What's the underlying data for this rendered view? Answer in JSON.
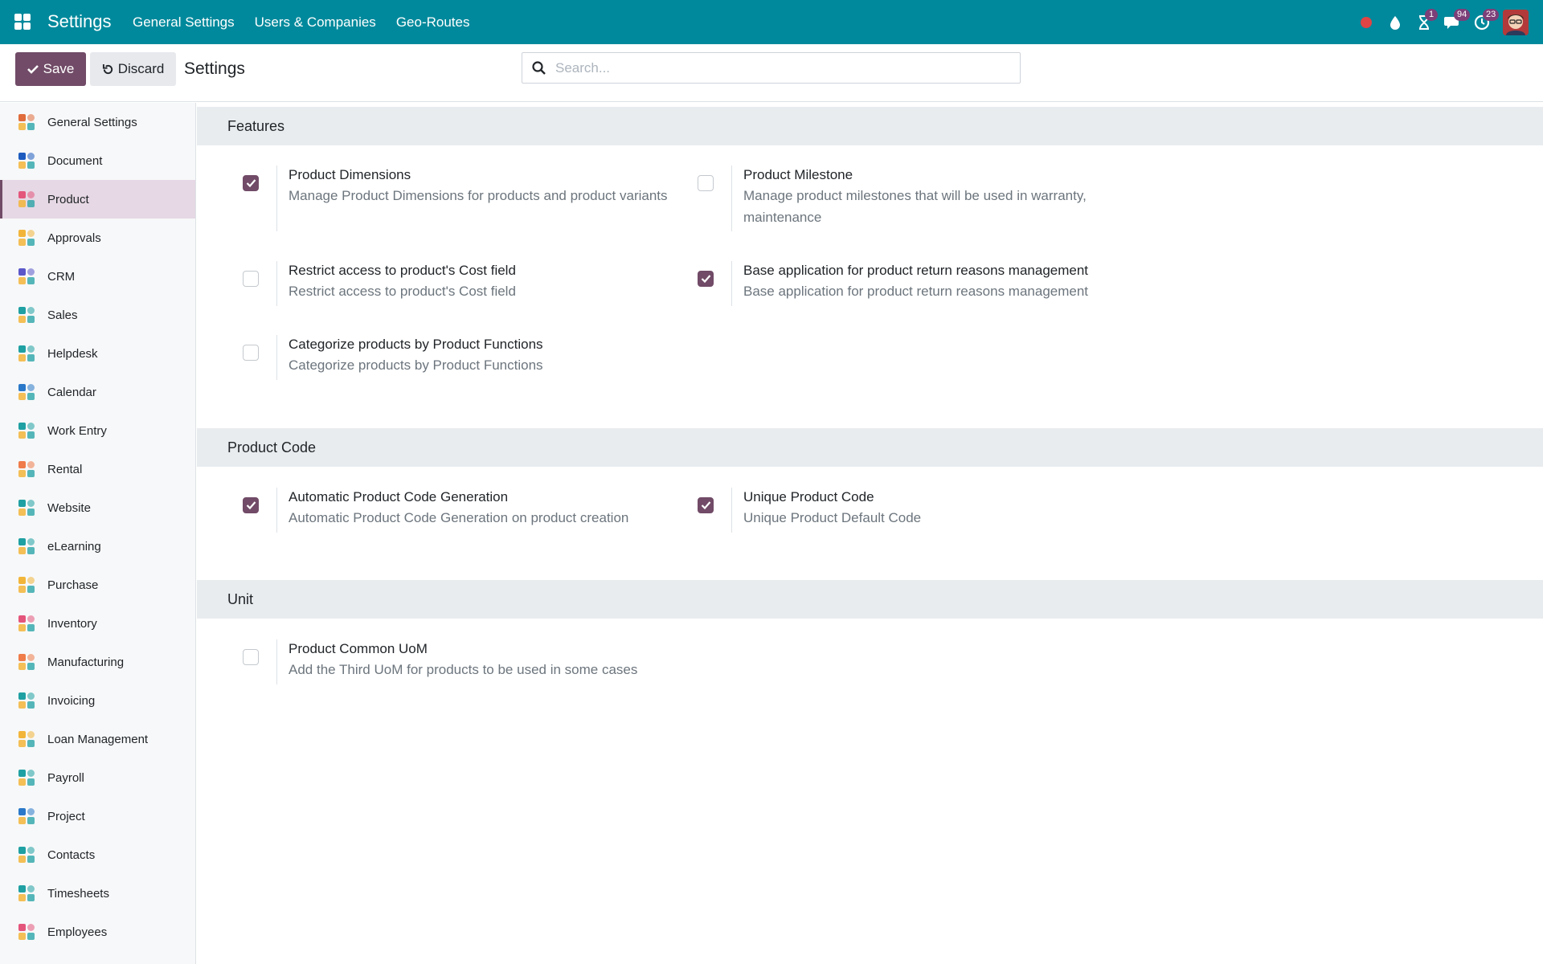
{
  "navbar": {
    "brand": "Settings",
    "menu": [
      "General Settings",
      "Users & Companies",
      "Geo-Routes"
    ],
    "tray": [
      {
        "icon": "record-dot-icon",
        "badge": null
      },
      {
        "icon": "drop-icon",
        "badge": null
      },
      {
        "icon": "hourglass-icon",
        "badge": "1"
      },
      {
        "icon": "chat-icon",
        "badge": "94"
      },
      {
        "icon": "clock-icon",
        "badge": "23"
      }
    ],
    "badge_color": "#7c3f78",
    "bar_color": "#00899c"
  },
  "control": {
    "save_label": "Save",
    "discard_label": "Discard",
    "title": "Settings",
    "search_placeholder": "Search..."
  },
  "sidebar": {
    "active": "Product",
    "items": [
      {
        "label": "General Settings",
        "icon": "settings-hexagon-icon",
        "color": "#e06b3c"
      },
      {
        "label": "Document",
        "icon": "folder-icon",
        "color": "#1d5bbf"
      },
      {
        "label": "Product",
        "icon": "product-blocks-icon",
        "color": "#e4557c"
      },
      {
        "label": "Approvals",
        "icon": "approvals-person-icon",
        "color": "#f2b53a"
      },
      {
        "label": "CRM",
        "icon": "crm-handshake-icon",
        "color": "#5b57c9"
      },
      {
        "label": "Sales",
        "icon": "sales-chart-icon",
        "color": "#1fa0a3"
      },
      {
        "label": "Helpdesk",
        "icon": "helpdesk-headset-icon",
        "color": "#1fa0a3"
      },
      {
        "label": "Calendar",
        "icon": "calendar-icon",
        "color": "#2a78c9"
      },
      {
        "label": "Work Entry",
        "icon": "work-entry-person-icon",
        "color": "#1fa0a3"
      },
      {
        "label": "Rental",
        "icon": "rental-hand-icon",
        "color": "#ef7c4a"
      },
      {
        "label": "Website",
        "icon": "website-globe-icon",
        "color": "#1fa0a3"
      },
      {
        "label": "eLearning",
        "icon": "elearning-board-icon",
        "color": "#1fa0a3"
      },
      {
        "label": "Purchase",
        "icon": "purchase-card-icon",
        "color": "#f2b53a"
      },
      {
        "label": "Inventory",
        "icon": "inventory-box-icon",
        "color": "#e4557c"
      },
      {
        "label": "Manufacturing",
        "icon": "manufacturing-factory-icon",
        "color": "#ef7c4a"
      },
      {
        "label": "Invoicing",
        "icon": "invoicing-dollar-icon",
        "color": "#1fa0a3"
      },
      {
        "label": "Loan Management",
        "icon": "loan-coins-icon",
        "color": "#f2b53a"
      },
      {
        "label": "Payroll",
        "icon": "payroll-badge-icon",
        "color": "#1fa0a3"
      },
      {
        "label": "Project",
        "icon": "project-rocket-icon",
        "color": "#2a78c9"
      },
      {
        "label": "Contacts",
        "icon": "contacts-book-icon",
        "color": "#1fa0a3"
      },
      {
        "label": "Timesheets",
        "icon": "timesheets-clock-icon",
        "color": "#1fa0a3"
      },
      {
        "label": "Employees",
        "icon": "employees-group-icon",
        "color": "#e4557c"
      }
    ]
  },
  "sections": [
    {
      "title": "Features",
      "settings": [
        {
          "title": "Product Dimensions",
          "desc": "Manage Product Dimensions for products and product variants",
          "checked": true
        },
        {
          "title": "Product Milestone",
          "desc": "Manage product milestones that will be used in warranty, maintenance",
          "checked": false
        },
        {
          "title": "Restrict access to product's Cost field",
          "desc": "Restrict access to product's Cost field",
          "checked": false
        },
        {
          "title": "Base application for product return reasons management",
          "desc": "Base application for product return reasons management",
          "checked": true
        },
        {
          "title": "Categorize products by Product Functions",
          "desc": "Categorize products by Product Functions",
          "checked": false
        }
      ]
    },
    {
      "title": "Product Code",
      "settings": [
        {
          "title": "Automatic Product Code Generation",
          "desc": "Automatic Product Code Generation on product creation",
          "checked": true
        },
        {
          "title": "Unique Product Code",
          "desc": "Unique Product Default Code",
          "checked": true
        }
      ]
    },
    {
      "title": "Unit",
      "settings": [
        {
          "title": "Product Common UoM",
          "desc": "Add the Third UoM for products to be used in some cases",
          "checked": false
        }
      ]
    }
  ]
}
